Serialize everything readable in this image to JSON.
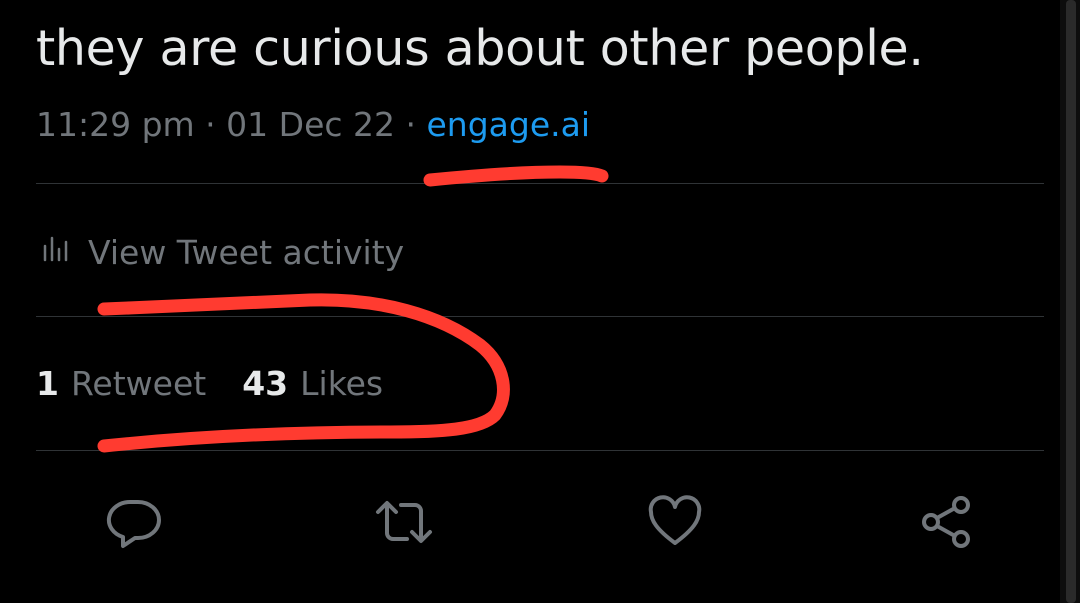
{
  "tweet": {
    "text": "they are curious about other people.",
    "time": "11:29 pm",
    "separator1": " · ",
    "date": "01 Dec 22",
    "separator2": " · ",
    "source": "engage.ai"
  },
  "activity": {
    "label": "View Tweet activity",
    "icon": "bar-chart-icon"
  },
  "stats": {
    "retweets_count": "1",
    "retweets_label": "Retweet",
    "likes_count": "43",
    "likes_label": "Likes"
  },
  "actions": [
    {
      "name": "reply",
      "icon": "reply-icon"
    },
    {
      "name": "retweet",
      "icon": "retweet-icon"
    },
    {
      "name": "like",
      "icon": "heart-icon"
    },
    {
      "name": "share",
      "icon": "share-icon"
    }
  ],
  "colors": {
    "background": "#000000",
    "text": "#e7e9ea",
    "secondary_text": "#71767b",
    "link": "#1d9bf0",
    "annotation": "#ff3b30"
  }
}
